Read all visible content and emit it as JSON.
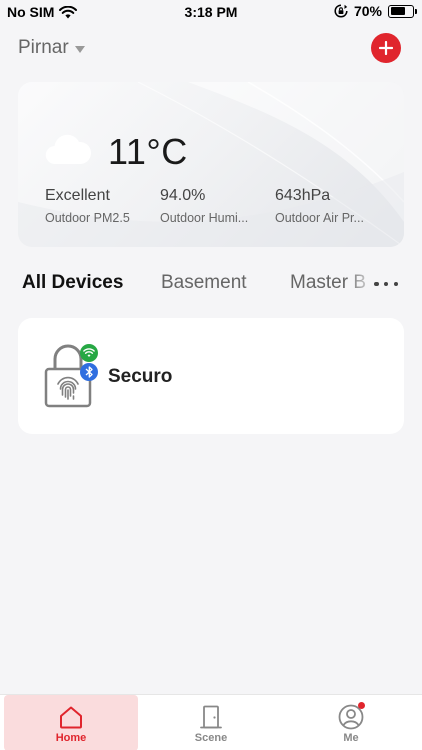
{
  "status_bar": {
    "carrier": "No SIM",
    "time": "3:18 PM",
    "battery_percent_label": "70%",
    "battery_level": 0.7
  },
  "header": {
    "home_name": "Pirnar",
    "add_button_color": "#e0252d"
  },
  "weather": {
    "temperature": "11°C",
    "metrics": [
      {
        "value": "Excellent",
        "label": "Outdoor PM2.5"
      },
      {
        "value": "94.0%",
        "label": "Outdoor Humi..."
      },
      {
        "value": "643hPa",
        "label": "Outdoor Air Pr..."
      }
    ]
  },
  "room_tabs": [
    "All Devices",
    "Basement",
    "Master B"
  ],
  "devices": [
    {
      "name": "Securo",
      "icon": "smart-lock-fingerprint-icon",
      "wifi_badge_color": "#27a844",
      "bluetooth_badge_color": "#2f6ee0"
    }
  ],
  "bottom_nav": [
    {
      "label": "Home",
      "icon": "home-icon",
      "active": true
    },
    {
      "label": "Scene",
      "icon": "door-icon",
      "active": false
    },
    {
      "label": "Me",
      "icon": "profile-icon",
      "active": false,
      "badge": true
    }
  ],
  "colors": {
    "accent": "#e0252d",
    "active_tab_bg": "#fadcdd",
    "background": "#f5f5f7"
  }
}
